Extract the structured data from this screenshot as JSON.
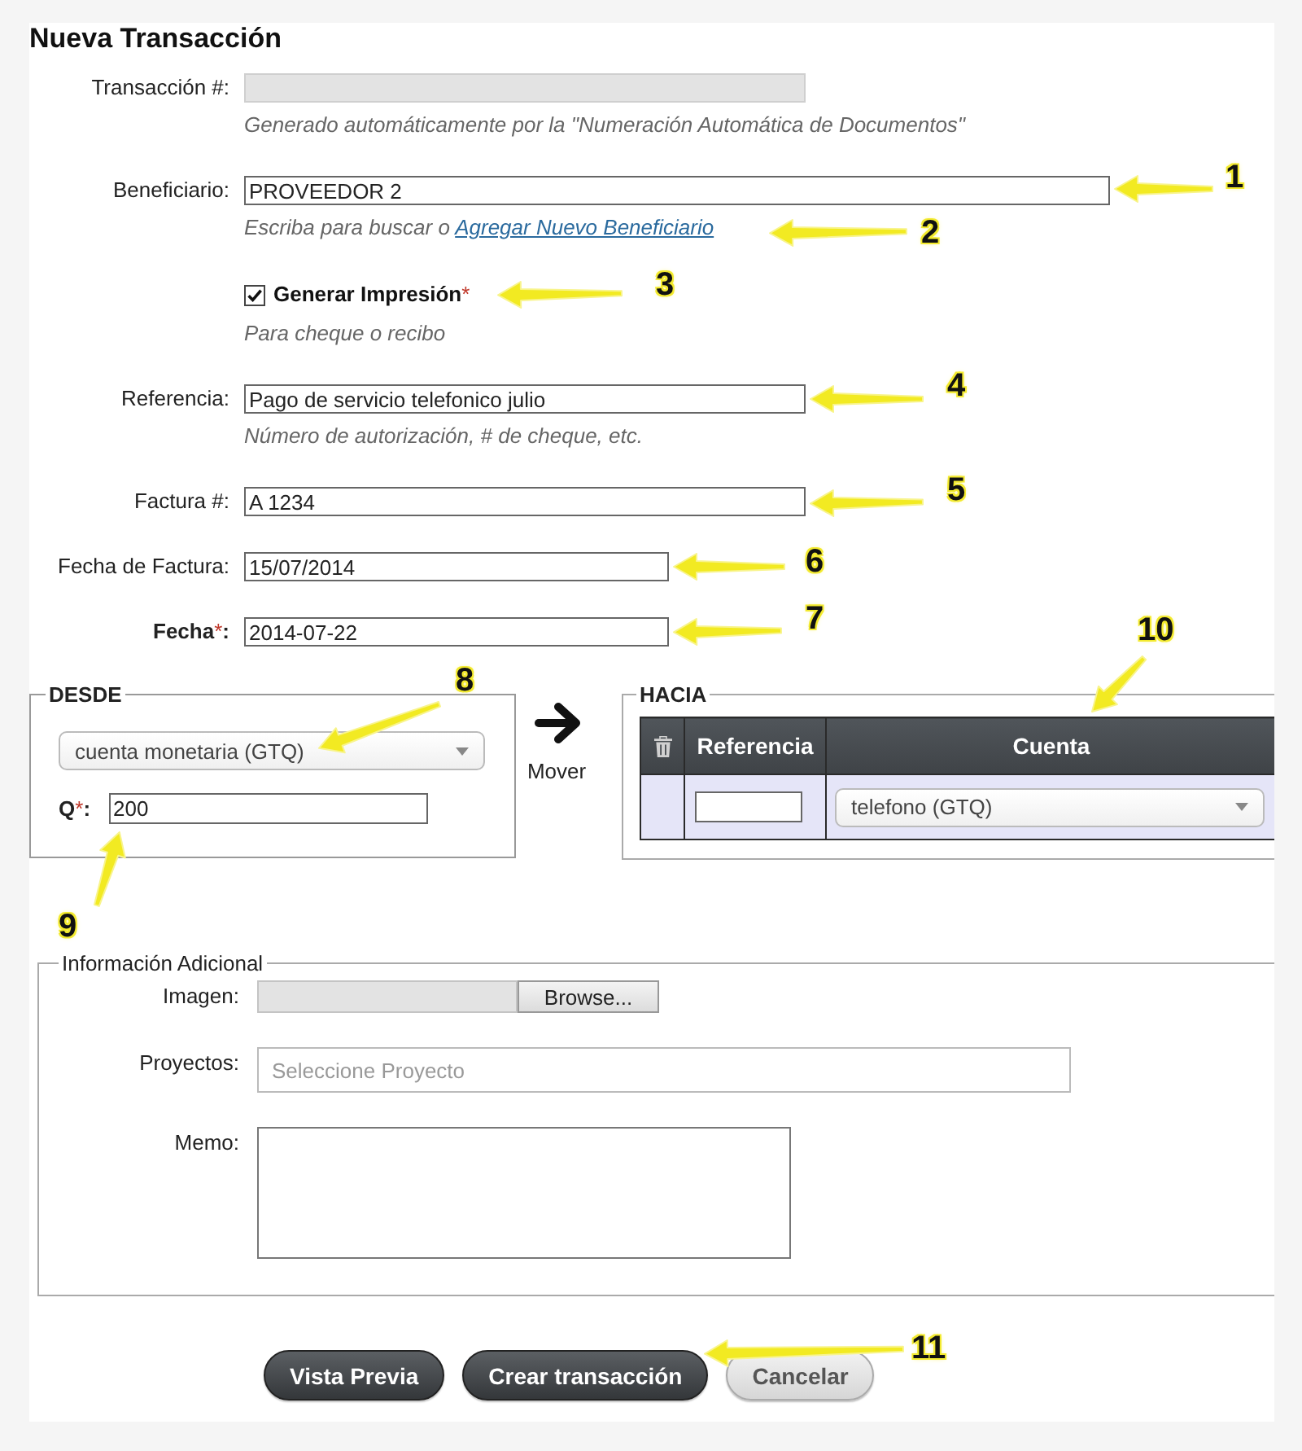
{
  "title": "Nueva Transacción",
  "fields": [
    {
      "kind": "text",
      "label": "Transacción #:",
      "disabled": true,
      "help": "Generado automáticamente por la \"Numeración Automática de Documentos\""
    },
    {
      "kind": "lookup",
      "label": "Beneficiario:",
      "value": "PROVEEDOR 2",
      "disabled": false,
      "help": "Escriba para buscar o ",
      "help_link": "Agregar Nuevo Beneficiario"
    },
    {
      "kind": "checkbox",
      "label": "Generar Impresión",
      "required_mark": "*",
      "checked": true,
      "disabled": false,
      "help": "Para cheque o recibo"
    },
    {
      "kind": "text",
      "label": "Referencia:",
      "value": "Pago de servicio telefonico julio",
      "disabled": false,
      "help": "Número de autorización, # de cheque, etc."
    },
    {
      "kind": "text",
      "label": "Factura #:",
      "value": "A 1234",
      "disabled": false
    },
    {
      "kind": "date",
      "label": "Fecha de Factura:",
      "value": "15/07/2014",
      "disabled": false
    },
    {
      "kind": "date",
      "label": "Fecha",
      "required_mark": "*",
      "label_end": ":",
      "value": "2014-07-22",
      "disabled": false
    }
  ],
  "desde": {
    "legend": "DESDE",
    "account": "cuenta monetaria (GTQ)",
    "amount": {
      "label": "Q",
      "required_mark": "*",
      "label_end": ":",
      "value": "200"
    }
  },
  "move": {
    "label": "Mover"
  },
  "hacia": {
    "legend": "HACIA",
    "columns": [
      {
        "kind": "delete"
      },
      {
        "kind": "text",
        "label": "Referencia"
      },
      {
        "kind": "text",
        "label": "Cuenta"
      }
    ],
    "rows": [
      {
        "account": "telefono (GTQ)"
      }
    ]
  },
  "extra": {
    "legend": "Información Adicional",
    "items": [
      {
        "kind": "file",
        "label": "Imagen:",
        "button": "Browse..."
      },
      {
        "kind": "select",
        "label": "Proyectos:",
        "placeholder": "Seleccione Proyecto"
      },
      {
        "kind": "textarea",
        "label": "Memo:"
      }
    ]
  },
  "buttons": [
    {
      "label": "Vista Previa",
      "kind": "primary"
    },
    {
      "label": "Crear transacción",
      "kind": "primary"
    },
    {
      "label": "Cancelar",
      "kind": "secondary"
    }
  ],
  "callouts": [
    {
      "number": "1"
    },
    {
      "number": "2"
    },
    {
      "number": "3"
    },
    {
      "number": "4"
    },
    {
      "number": "5"
    },
    {
      "number": "6"
    },
    {
      "number": "7"
    },
    {
      "number": "8"
    },
    {
      "number": "9"
    },
    {
      "number": "10"
    },
    {
      "number": "11"
    }
  ]
}
